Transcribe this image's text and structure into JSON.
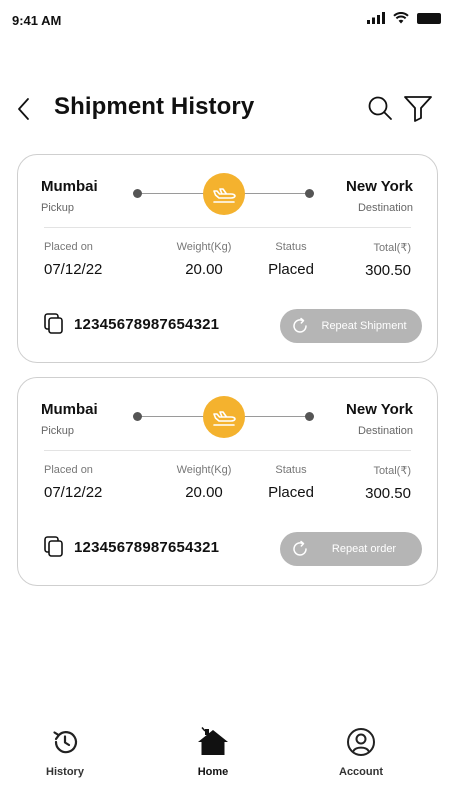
{
  "status_bar": {
    "time": "9:41 AM"
  },
  "header": {
    "title": "Shipment History"
  },
  "shipments": [
    {
      "origin": {
        "city": "Mumbai",
        "label": "Pickup"
      },
      "destination": {
        "city": "New York",
        "label": "Destination"
      },
      "placed_on": {
        "label": "Placed on",
        "value": "07/12/22"
      },
      "weight": {
        "label": "Weight(Kg)",
        "value": "20.00"
      },
      "status": {
        "label": "Status",
        "value": "Placed"
      },
      "total": {
        "label": "Total(₹)",
        "value": "300.50"
      },
      "tracking_number": "12345678987654321",
      "action_label": "Repeat Shipment"
    },
    {
      "origin": {
        "city": "Mumbai",
        "label": "Pickup"
      },
      "destination": {
        "city": "New York",
        "label": "Destination"
      },
      "placed_on": {
        "label": "Placed on",
        "value": "07/12/22"
      },
      "weight": {
        "label": "Weight(Kg)",
        "value": "20.00"
      },
      "status": {
        "label": "Status",
        "value": "Placed"
      },
      "total": {
        "label": "Total(₹)",
        "value": "300.50"
      },
      "tracking_number": "12345678987654321",
      "action_label": "Repeat order"
    }
  ],
  "bottom_nav": {
    "items": [
      {
        "label": "History",
        "icon": "history-icon"
      },
      {
        "label": "Home",
        "icon": "home-icon"
      },
      {
        "label": "Account",
        "icon": "account-icon"
      }
    ]
  },
  "colors": {
    "accent": "#f4b22e",
    "button_disabled": "#b5b5b5",
    "card_border": "#cfcfcf"
  }
}
